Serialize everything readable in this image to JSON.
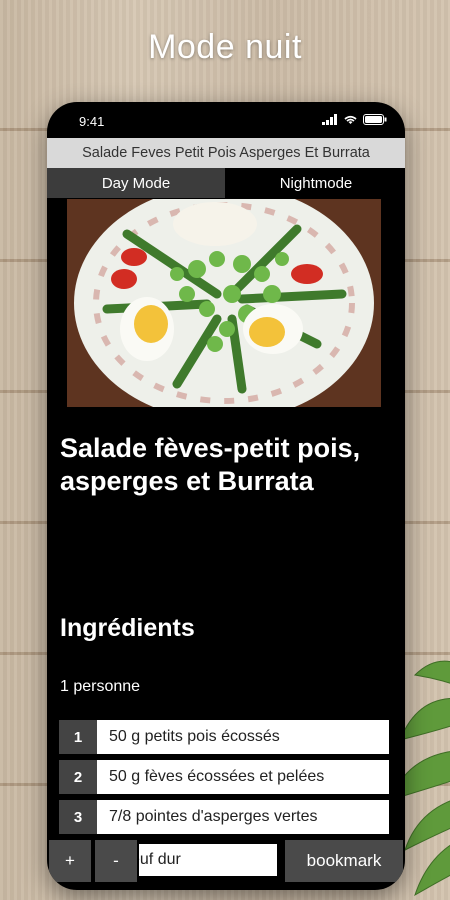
{
  "headline": "Mode nuit",
  "status": {
    "time": "9:41"
  },
  "app": {
    "title": "Salade Feves Petit Pois Asperges Et Burrata"
  },
  "mode_tabs": {
    "day": "Day Mode",
    "night": "Nightmode",
    "active": "night"
  },
  "recipe": {
    "title": "Salade fèves-petit pois, asperges et Burrata",
    "ingredients_heading": "Ingrédients",
    "servings": "1 personne",
    "ingredients": [
      {
        "num": "1",
        "text": "50 g petits pois écossés"
      },
      {
        "num": "2",
        "text": "50 g fèves écossées et pelées"
      },
      {
        "num": "3",
        "text": "7/8 pointes d'asperges vertes"
      }
    ],
    "partial_ingredient": "euf dur"
  },
  "bottom_bar": {
    "plus": "+",
    "minus": "-",
    "bookmark": "bookmark"
  },
  "colors": {
    "background": "#000000",
    "title_bar": "#d9d9d9",
    "button": "#4a4a4a"
  }
}
